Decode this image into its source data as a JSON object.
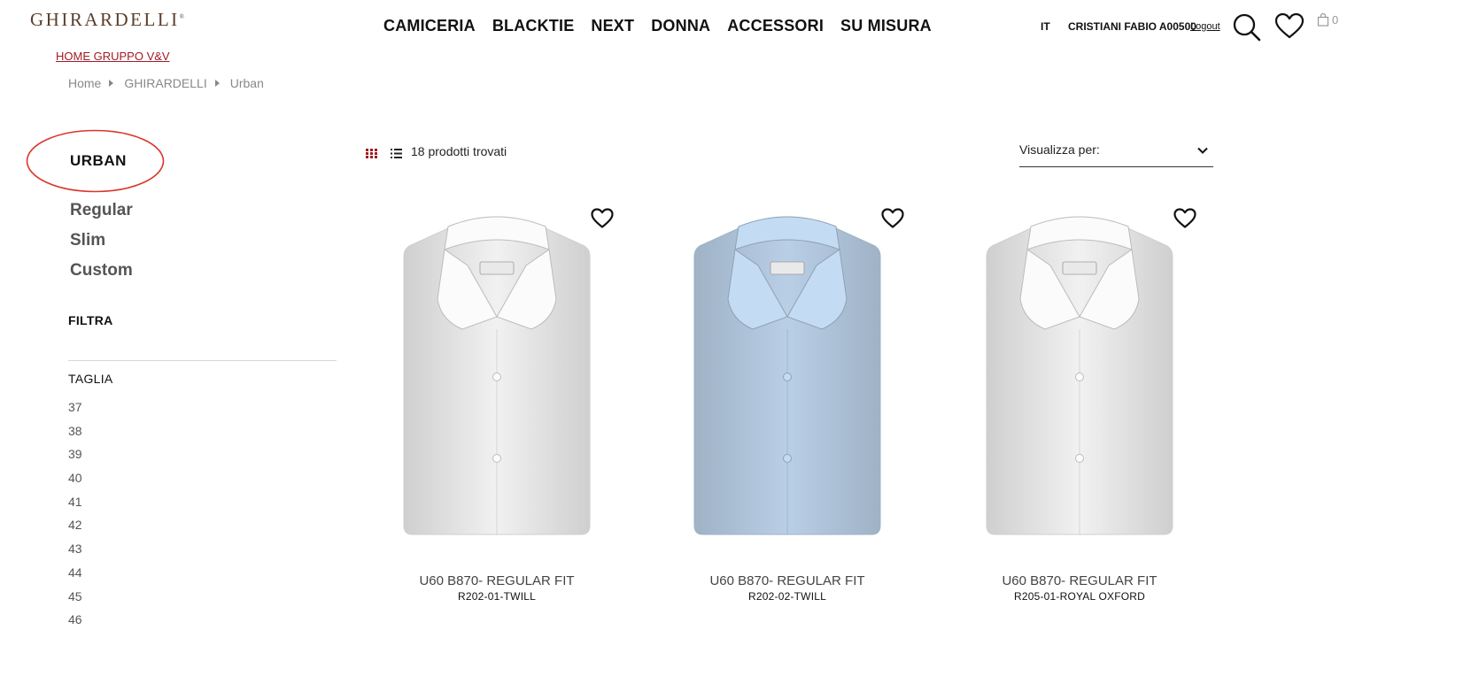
{
  "header": {
    "logo_text": "GHIRARDELLI",
    "logo_mark": "®",
    "nav": [
      "CAMICERIA",
      "BLACKTIE",
      "NEXT",
      "DONNA",
      "ACCESSORI",
      "SU MISURA"
    ],
    "language": "IT",
    "user_name": "CRISTIANI FABIO A00500",
    "logout_label": "Logout",
    "cart_count": "0",
    "icons": [
      "search-icon",
      "heart-icon",
      "shopping-bag-icon"
    ]
  },
  "home_link": "HOME GRUPPO V&V",
  "breadcrumb": [
    "Home",
    "GHIRARDELLI",
    "Urban"
  ],
  "sidebar": {
    "category_title": "URBAN",
    "fits": [
      "Regular",
      "Slim",
      "Custom"
    ],
    "filter_title": "FILTRA",
    "size_title": "TAGLIA",
    "sizes": [
      "37",
      "38",
      "39",
      "40",
      "41",
      "42",
      "43",
      "44",
      "45",
      "46"
    ]
  },
  "toolbar": {
    "count_text": "18 prodotti trovati",
    "sort_label": "Visualizza per:"
  },
  "products": [
    {
      "name": "U60 B870- REGULAR FIT",
      "code": "R202-01-TWILL",
      "color": "#ffffff"
    },
    {
      "name": "U60 B870- REGULAR FIT",
      "code": "R202-02-TWILL",
      "color": "#b9cfe6"
    },
    {
      "name": "U60 B870- REGULAR FIT",
      "code": "R205-01-ROYAL OXFORD",
      "color": "#ffffff"
    }
  ],
  "colors": {
    "accent": "#a01c24",
    "logo": "#5a3e2b",
    "highlight_circle": "#d9362b"
  }
}
